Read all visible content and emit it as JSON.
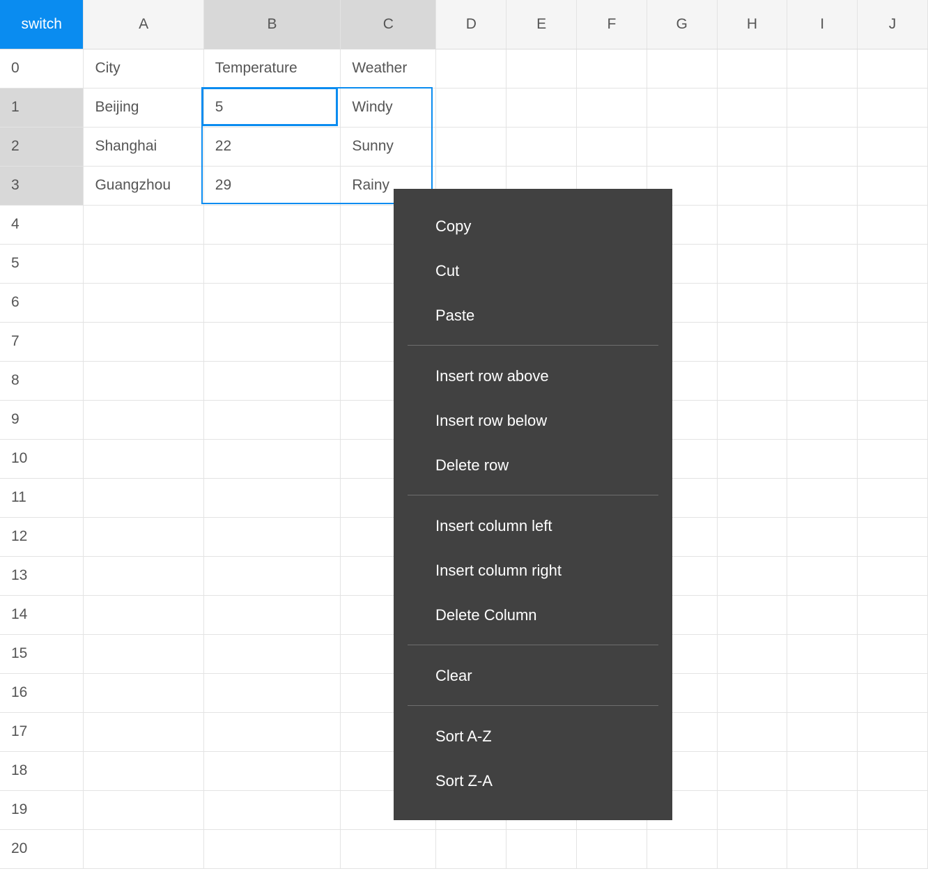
{
  "grid": {
    "corner_label": "switch",
    "column_headers": [
      "A",
      "B",
      "C",
      "D",
      "E",
      "F",
      "G",
      "H",
      "I",
      "J"
    ],
    "highlighted_columns": [
      "B",
      "C"
    ],
    "row_headers": [
      "0",
      "1",
      "2",
      "3",
      "4",
      "5",
      "6",
      "7",
      "8",
      "9",
      "10",
      "11",
      "12",
      "13",
      "14",
      "15",
      "16",
      "17",
      "18",
      "19",
      "20"
    ],
    "highlighted_rows": [
      "1",
      "2",
      "3"
    ],
    "rows": [
      {
        "num": "0",
        "cells": [
          "City",
          "Temperature",
          "Weather"
        ]
      },
      {
        "num": "1",
        "cells": [
          "Beijing",
          "5",
          "Windy"
        ]
      },
      {
        "num": "2",
        "cells": [
          "Shanghai",
          "22",
          "Sunny"
        ]
      },
      {
        "num": "3",
        "cells": [
          "Guangzhou",
          "29",
          "Rainy"
        ]
      }
    ],
    "selection": {
      "range": "B1:C3",
      "anchor": "B1",
      "border_color": "#0a8cf0",
      "fill_color": "#e6f3fc"
    },
    "accent_color": "#0a8cf0",
    "header_bg": "#f5f5f5",
    "header_highlight_bg": "#d8d8d8",
    "grid_line_color": "#e3e3e3",
    "text_color": "#555555"
  },
  "context_menu": {
    "background": "#414141",
    "text_color": "#ffffff",
    "groups": [
      {
        "items": [
          "Copy",
          "Cut",
          "Paste"
        ]
      },
      {
        "items": [
          "Insert row above",
          "Insert row below",
          "Delete row"
        ]
      },
      {
        "items": [
          "Insert column left",
          "Insert column right",
          "Delete Column"
        ]
      },
      {
        "items": [
          "Clear"
        ]
      },
      {
        "items": [
          "Sort A-Z",
          "Sort Z-A"
        ]
      }
    ]
  }
}
